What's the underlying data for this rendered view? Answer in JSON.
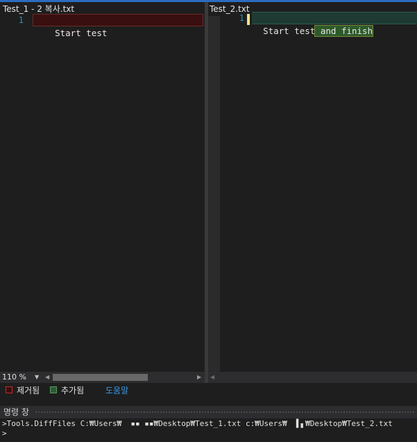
{
  "left_file": {
    "title": "Test_1 - 2 복사.txt",
    "line_number": "1",
    "text": "Start test"
  },
  "right_file": {
    "title": "Test_2.txt",
    "line_number": "1",
    "text_common": "Start test",
    "text_added": " and finish"
  },
  "zoom": {
    "value": "110 %"
  },
  "legend": {
    "removed": "제거됨",
    "added": "추가됨",
    "help": "도움말",
    "removed_color": "#c42b2b",
    "added_color": "#3e8a3e"
  },
  "command_window": {
    "title": "명령 창",
    "command": ">Tools.DiffFiles C:₩Users₩  ▪▪ ▪▪₩Desktop₩Test_1.txt c:₩Users₩  ▌▖₩Desktop₩Test_2.txt",
    "prompt": ">"
  }
}
